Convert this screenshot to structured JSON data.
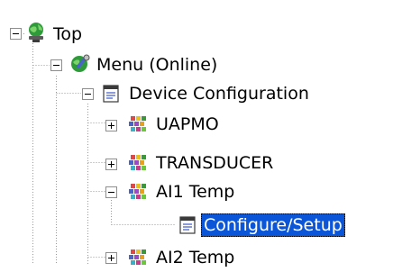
{
  "tree": {
    "nodes": [
      {
        "label": "Top",
        "icon": "globe-computer-icon",
        "toggle": "collapse"
      },
      {
        "label": "Menu (Online)",
        "icon": "menu-tools-icon",
        "toggle": "collapse"
      },
      {
        "label": "Device Configuration",
        "icon": "folder-page-icon",
        "toggle": "collapse"
      },
      {
        "label": "UAPMO",
        "icon": "block-icon",
        "toggle": "expand"
      },
      {
        "label": "TRANSDUCER",
        "icon": "block-icon",
        "toggle": "expand"
      },
      {
        "label": "AI1 Temp",
        "icon": "block-icon",
        "toggle": "collapse"
      },
      {
        "label": "Configure/Setup",
        "icon": "page-icon",
        "toggle": "none",
        "selected": true
      },
      {
        "label": "AI2 Temp",
        "icon": "block-icon",
        "toggle": "expand"
      }
    ]
  },
  "colors": {
    "selection": "#0a55d8",
    "tree_lines": "#9a9a9a"
  }
}
